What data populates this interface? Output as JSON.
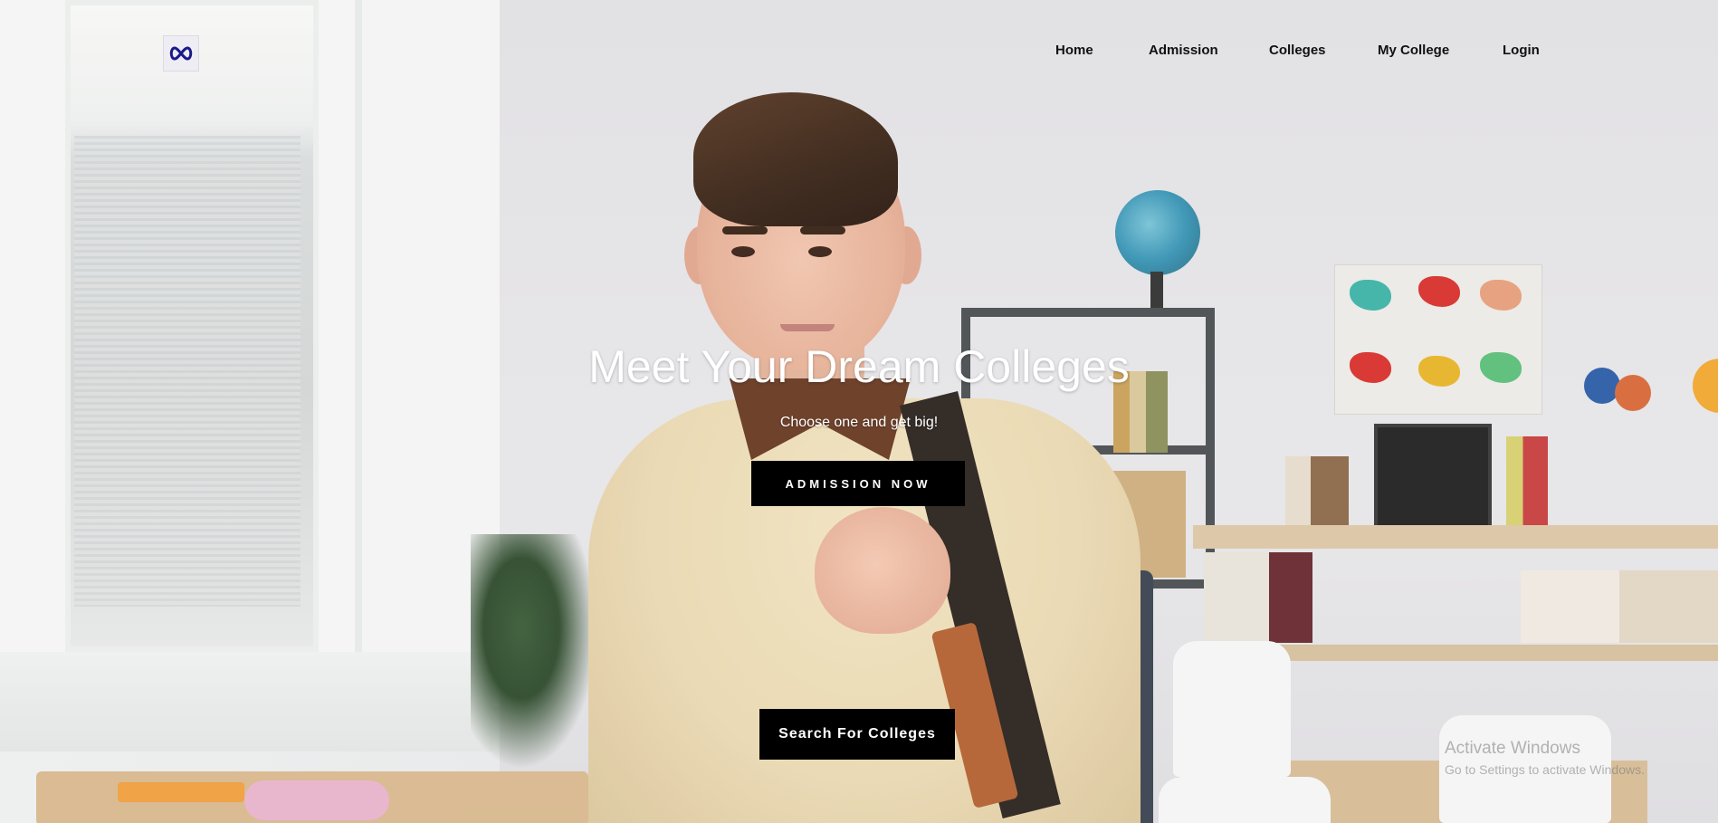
{
  "brand": {
    "logo_icon": "infinity-icon",
    "logo_color": "#1a1a8c"
  },
  "nav": {
    "items": [
      {
        "label": "Home"
      },
      {
        "label": "Admission"
      },
      {
        "label": "Colleges"
      },
      {
        "label": "My College"
      },
      {
        "label": "Login"
      }
    ]
  },
  "hero": {
    "title": "Meet Your Dream Colleges",
    "subtitle": "Choose one and get big!",
    "admission_button": "ADMISSION NOW",
    "search_button": "Search For Colleges"
  },
  "os_watermark": {
    "line1": "Activate Windows",
    "line2": "Go to Settings to activate Windows."
  },
  "colors": {
    "button_bg": "#000000",
    "button_text": "#ffffff",
    "nav_text": "#111111",
    "hero_text": "#ffffff"
  }
}
